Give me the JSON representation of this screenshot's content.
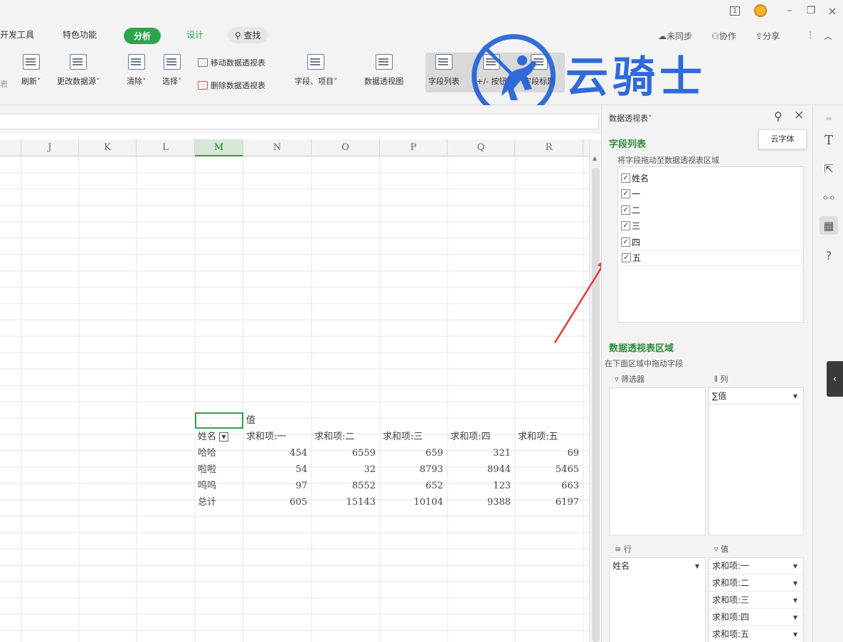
{
  "titlebar": {
    "page_indicator": "1",
    "minimize": "–",
    "restore": "❐",
    "close": "×"
  },
  "tabs": {
    "dev_tools": "开发工具",
    "special": "特色功能",
    "analyze": "分析",
    "design": "设计",
    "search": "查找",
    "unsynced": "未同步",
    "collaborate": "协作",
    "share": "分享"
  },
  "ribbon": {
    "partial_left": "表",
    "refresh": "刷新˅",
    "change_source": "更改数据源˅",
    "clear": "清除˅",
    "select": "选择˅",
    "move_pivot": "移动数据透视表",
    "delete_pivot": "删除数据透视表",
    "fields_items": "字段、项目˅",
    "pivot_chart": "数据透视图",
    "field_list": "字段列表",
    "buttons": "+/- 按钮",
    "field_headers": "字段标题"
  },
  "watermark": {
    "text": "云骑士"
  },
  "columns": [
    "J",
    "K",
    "L",
    "M",
    "N",
    "O",
    "P",
    "Q",
    "R"
  ],
  "pivot": {
    "value_label": "值",
    "headers": [
      "姓名",
      "求和项:一",
      "求和项:二",
      "求和项:三",
      "求和项:四",
      "求和项:五"
    ],
    "rows": [
      {
        "name": "哈哈",
        "values": [
          "454",
          "6559",
          "659",
          "321",
          "69"
        ]
      },
      {
        "name": "啦啦",
        "values": [
          "54",
          "32",
          "8793",
          "8944",
          "5465"
        ]
      },
      {
        "name": "呜呜",
        "values": [
          "97",
          "8552",
          "652",
          "123",
          "663"
        ]
      },
      {
        "name": "总计",
        "values": [
          "605",
          "15143",
          "10104",
          "9388",
          "6197"
        ]
      }
    ]
  },
  "panel": {
    "title": "数据透视表˅",
    "field_list_title": "字段列表",
    "field_list_hint": "将字段拖动至数据透视表区域",
    "fields": [
      {
        "label": "姓名",
        "checked": true
      },
      {
        "label": "一",
        "checked": true
      },
      {
        "label": "二",
        "checked": true
      },
      {
        "label": "三",
        "checked": true
      },
      {
        "label": "四",
        "checked": true
      },
      {
        "label": "五",
        "checked": true
      }
    ],
    "areas_title": "数据透视表区域",
    "areas_hint": "在下面区域中拖动字段",
    "filter_label": "筛选器",
    "column_label": "列",
    "column_item": "∑值",
    "row_label": "行",
    "row_item": "姓名",
    "value_label": "值",
    "value_items": [
      "求和项:一",
      "求和项:二",
      "求和项:三",
      "求和项:四",
      "求和项:五"
    ]
  },
  "tooltip": "云字体",
  "colors": {
    "accent": "#2ea44f",
    "logo": "#1e5fd6",
    "arrow": "#e53935"
  }
}
